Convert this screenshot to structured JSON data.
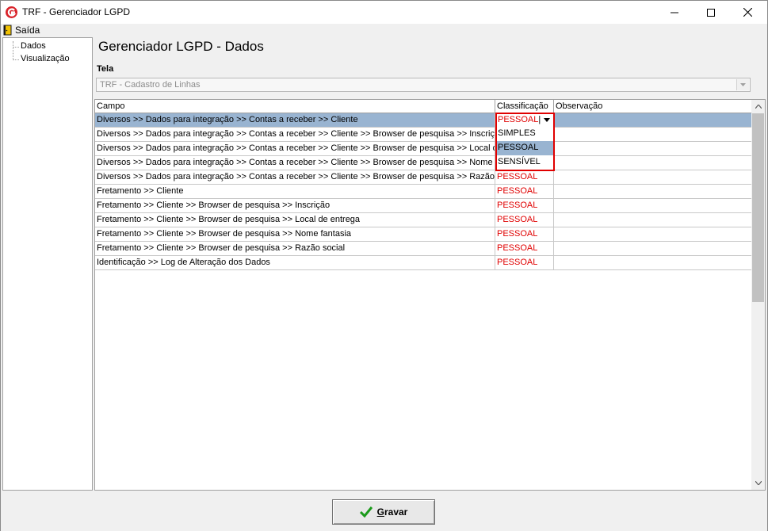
{
  "window": {
    "title": "TRF - Gerenciador LGPD"
  },
  "menu": {
    "exit_label": "Saída"
  },
  "tree": {
    "items": [
      "Dados",
      "Visualização"
    ]
  },
  "main": {
    "page_title": "Gerenciador LGPD - Dados",
    "tela_label": "Tela",
    "tela_value": "TRF - Cadastro de Linhas"
  },
  "grid": {
    "headers": {
      "campo": "Campo",
      "classificacao": "Classificação",
      "observacao": "Observação"
    },
    "rows": [
      {
        "campo": "Diversos >> Dados para integração >> Contas a receber >> Cliente",
        "classificacao": "PESSOAL",
        "observacao": ""
      },
      {
        "campo": "Diversos >> Dados para integração >> Contas a receber >> Cliente >> Browser de pesquisa >> Inscrição",
        "classificacao": "",
        "observacao": ""
      },
      {
        "campo": "Diversos >> Dados para integração >> Contas a receber >> Cliente >> Browser de pesquisa >> Local de...",
        "classificacao": "",
        "observacao": ""
      },
      {
        "campo": "Diversos >> Dados para integração >> Contas a receber >> Cliente >> Browser de pesquisa >> Nome fa...",
        "classificacao": "",
        "observacao": ""
      },
      {
        "campo": "Diversos >> Dados para integração >> Contas a receber >> Cliente >> Browser de pesquisa >> Razão s...",
        "classificacao": "PESSOAL",
        "observacao": ""
      },
      {
        "campo": "Fretamento >> Cliente",
        "classificacao": "PESSOAL",
        "observacao": ""
      },
      {
        "campo": "Fretamento >> Cliente >> Browser de pesquisa >> Inscrição",
        "classificacao": "PESSOAL",
        "observacao": ""
      },
      {
        "campo": "Fretamento >> Cliente >> Browser de pesquisa >> Local de entrega",
        "classificacao": "PESSOAL",
        "observacao": ""
      },
      {
        "campo": "Fretamento >> Cliente >> Browser de pesquisa >> Nome fantasia",
        "classificacao": "PESSOAL",
        "observacao": ""
      },
      {
        "campo": "Fretamento >> Cliente >> Browser de pesquisa >> Razão social",
        "classificacao": "PESSOAL",
        "observacao": ""
      },
      {
        "campo": "Identificação >> Log de Alteração dos Dados",
        "classificacao": "PESSOAL",
        "observacao": ""
      }
    ],
    "selected_row": 0
  },
  "dropdown": {
    "current_value": "PESSOAL",
    "options": [
      "SIMPLES",
      "PESSOAL",
      "SENSÍVEL"
    ],
    "hovered_option": 1
  },
  "footer": {
    "save_label_first": "G",
    "save_label_rest": "ravar"
  },
  "colors": {
    "classification_text": "#e00000",
    "selection": "#99b4d1",
    "highlight_box": "#e00000",
    "check_icon": "#1a9a1a"
  }
}
